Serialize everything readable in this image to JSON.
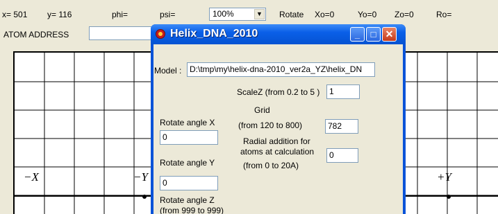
{
  "status": {
    "x": "x= 501",
    "y": "y= 116",
    "phi": "phi=",
    "psi": "psi=",
    "zoom": "100%",
    "rotate": "Rotate",
    "xo": "Xo=0",
    "yo": "Yo=0",
    "zo": "Zo=0",
    "ro": "Ro="
  },
  "atom_address": {
    "label": "ATOM ADDRESS",
    "value": ""
  },
  "canvas": {
    "labels": {
      "neg_x": "−X",
      "neg_y": "−Y",
      "pos_y": "+Y"
    }
  },
  "dialog": {
    "title": "Helix_DNA_2010",
    "buttons": {
      "minimize": "_",
      "maximize": "□",
      "close": "✕"
    },
    "model_label": "Model :",
    "model_value": "D:\\tmp\\my\\helix-dna-2010_ver2a_YZ\\helix_DN",
    "scalez_label": "ScaleZ (from 0.2 to 5 )",
    "scalez_value": "1",
    "grid_label": "Grid",
    "grid_range": "(from 120 to 800)",
    "grid_value": "782",
    "radial_line1": "Radial addition for",
    "radial_line2": "atoms at calculation",
    "radial_line3": "(from 0 to 20A)",
    "radial_value": "0",
    "rotx_label": "Rotate angle X",
    "rotx_value": "0",
    "roty_label": "Rotate angle Y",
    "roty_value": "0",
    "rotz_label": "Rotate angle  Z",
    "rotz_range": "(from 999 to 999)"
  },
  "icons": {
    "window_icon": "app-icon",
    "dropdown": "chevron-down-icon"
  }
}
